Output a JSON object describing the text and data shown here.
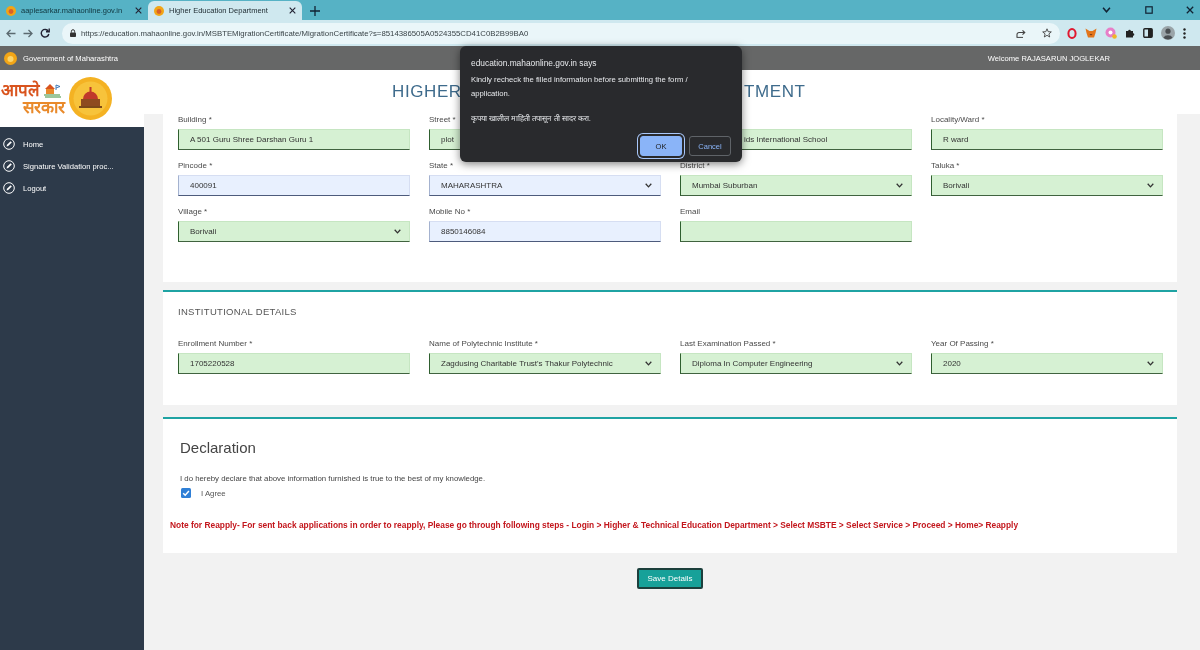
{
  "browser": {
    "tabs": [
      {
        "title": "aaplesarkar.mahaonline.gov.in",
        "selected": false
      },
      {
        "title": "Higher Education Department",
        "selected": true
      }
    ],
    "url": "https://education.mahaonline.gov.in/MSBTEMigrationCertificate/MigrationCertificate?s=8514386505A0524355CD41C0B2B99BA0"
  },
  "site_header": {
    "government": "Government of Maharashtra",
    "welcome": "Welcome RAJASARUN JOGLEKAR",
    "logo_lines": [
      "आपले",
      "सरकार"
    ],
    "title_visible_start": "HIGHER",
    "title_visible_end": "TMENT"
  },
  "sidebar": {
    "items": [
      {
        "label": "Home",
        "selected": false
      },
      {
        "label": "Signature Validation proc...",
        "selected": false
      },
      {
        "label": "Logout",
        "selected": false
      }
    ]
  },
  "address": {
    "fields": [
      {
        "label": "Building *",
        "value": "A 501 Guru Shree Darshan Guru 1",
        "kind": "input",
        "autofilled": false
      },
      {
        "label": "Street *",
        "value": "plot",
        "kind": "input",
        "autofilled": false
      },
      {
        "value": "ids International School",
        "kind": "input",
        "autofilled": false
      },
      {
        "label": "Locality/Ward *",
        "value": "R ward",
        "kind": "input",
        "autofilled": false
      },
      {
        "label": "Pincode *",
        "value": "400091",
        "kind": "input",
        "autofilled": true
      },
      {
        "label": "State *",
        "value": "MAHARASHTRA",
        "kind": "select",
        "autofilled": true
      },
      {
        "label": "District *",
        "value": "Mumbai Suburban",
        "kind": "select",
        "autofilled": false
      },
      {
        "label": "Taluka *",
        "value": "Borivali",
        "kind": "select",
        "autofilled": false
      },
      {
        "label": "Village *",
        "value": "Borivali",
        "kind": "select",
        "autofilled": false
      },
      {
        "label": "Mobile No *",
        "value": "8850146084",
        "kind": "input",
        "autofilled": true
      },
      {
        "label": "Email",
        "kind": "input",
        "autofilled": false
      }
    ]
  },
  "institutional": {
    "title": "INSTITUTIONAL DETAILS",
    "fields": [
      {
        "label": "Enrollment Number *",
        "value": "1705220528",
        "kind": "input",
        "autofilled": false
      },
      {
        "label": "Name of Polytechnic Institute *",
        "value": "Zagdusing Charitable Trust's Thakur Polytechnic",
        "kind": "select",
        "autofilled": false
      },
      {
        "label": "Last Examination Passed *",
        "value": "Diploma In Computer Engineering",
        "kind": "select",
        "autofilled": false
      },
      {
        "label": "Year Of Passing *",
        "value": "2020",
        "kind": "select",
        "autofilled": false
      }
    ]
  },
  "declaration": {
    "title": "Declaration",
    "statement": "I do hereby declare that above information furnished is true to the best of my knowledge.",
    "agree": {
      "label": "I Agree",
      "checked": true
    },
    "note": "Note for Reapply- For sent back applications in order to reapply, Please go through following steps - Login > Higher & Technical Education Department > Select MSBTE > Select Service > Proceed > Home> Reapply"
  },
  "save_button": {
    "label": "Save Details"
  },
  "dialog": {
    "origin": "education.mahaonline.gov.in says",
    "message": "Kindly recheck the filled information before submitting the form / application.",
    "message_marathi": "कृपया खालील माहिती तपासून ती सादर करा.",
    "buttons": [
      {
        "label": "OK",
        "kind": "primary"
      },
      {
        "label": "Cancel",
        "kind": "secondary"
      }
    ]
  }
}
